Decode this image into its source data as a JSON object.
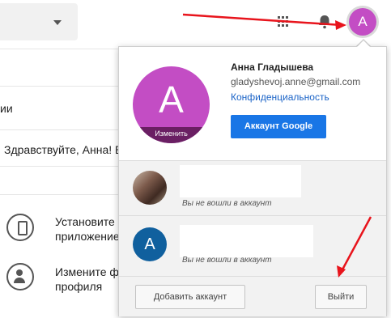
{
  "background": {
    "section_label_1": "ии",
    "greeting": "Здравствуйте, Анна! В",
    "item_install_line1": "Установите",
    "item_install_line2": "приложение",
    "item_profile_line1": "Измените ф",
    "item_profile_line2": "профиля"
  },
  "topbar": {
    "avatar_letter": "A"
  },
  "account_popup": {
    "avatar_letter": "A",
    "avatar_edit_label": "Изменить",
    "user_name": "Анна Гладышева",
    "user_email": "gladyshevoj.anne@gmail.com",
    "privacy_link": "Конфиденциальность",
    "google_account_button": "Аккаунт Google",
    "accounts": [
      {
        "status": "Вы не вошли в аккаунт"
      },
      {
        "avatar_letter": "A",
        "status": "Вы не вошли в аккаунт"
      }
    ],
    "add_account_button": "Добавить аккаунт",
    "sign_out_button": "Выйти"
  },
  "colors": {
    "avatar_purple": "#c34dc4",
    "link_blue": "#1a63c7",
    "button_blue": "#1976e6",
    "annotation_red": "#e8141c"
  }
}
